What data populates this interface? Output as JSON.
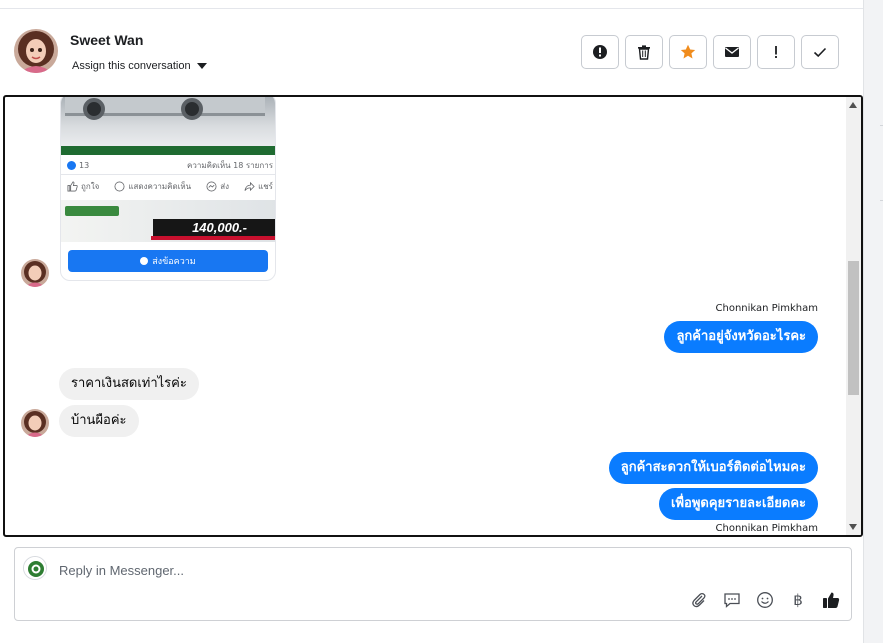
{
  "header": {
    "contact_name": "Sweet Wan",
    "assign_label": "Assign this conversation",
    "actions": [
      {
        "name": "mark-spam-button",
        "icon": "alert-circle-icon"
      },
      {
        "name": "delete-button",
        "icon": "trash-icon"
      },
      {
        "name": "star-button",
        "icon": "star-icon"
      },
      {
        "name": "mark-unread-button",
        "icon": "envelope-icon"
      },
      {
        "name": "follow-up-button",
        "icon": "exclamation-icon"
      },
      {
        "name": "mark-done-button",
        "icon": "check-icon"
      }
    ]
  },
  "ad_card": {
    "like_count": "13",
    "comment_count": "ความคิดเห็น 18 รายการ",
    "reactions": [
      "ถูกใจ",
      "แสดงความคิดเห็น",
      "ส่ง",
      "แชร์"
    ],
    "price": "140,000.-",
    "send_button_label": "ส่งข้อความ"
  },
  "messages": [
    {
      "id": "m1",
      "direction": "out",
      "sender": "Chonnikan Pimkham",
      "text": "ลูกค้าอยู่จังหวัดอะไรคะ"
    },
    {
      "id": "m2",
      "direction": "in",
      "text": "ราคาเงินสดเท่าไรค่ะ"
    },
    {
      "id": "m3",
      "direction": "in",
      "text": "บ้านผือค่ะ"
    },
    {
      "id": "m4",
      "direction": "out",
      "text": "ลูกค้าสะดวกให้เบอร์ติดต่อไหมคะ"
    },
    {
      "id": "m5",
      "direction": "out",
      "sender": "Chonnikan Pimkham",
      "text": "เพื่อพูดคุยรายละเอียดคะ"
    }
  ],
  "reply": {
    "placeholder": "Reply in Messenger...",
    "currency_symbol": "฿"
  },
  "colors": {
    "brand_blue": "#0a7cff",
    "star_orange": "#f08c1d",
    "incoming_bubble": "#f0f0f0"
  }
}
